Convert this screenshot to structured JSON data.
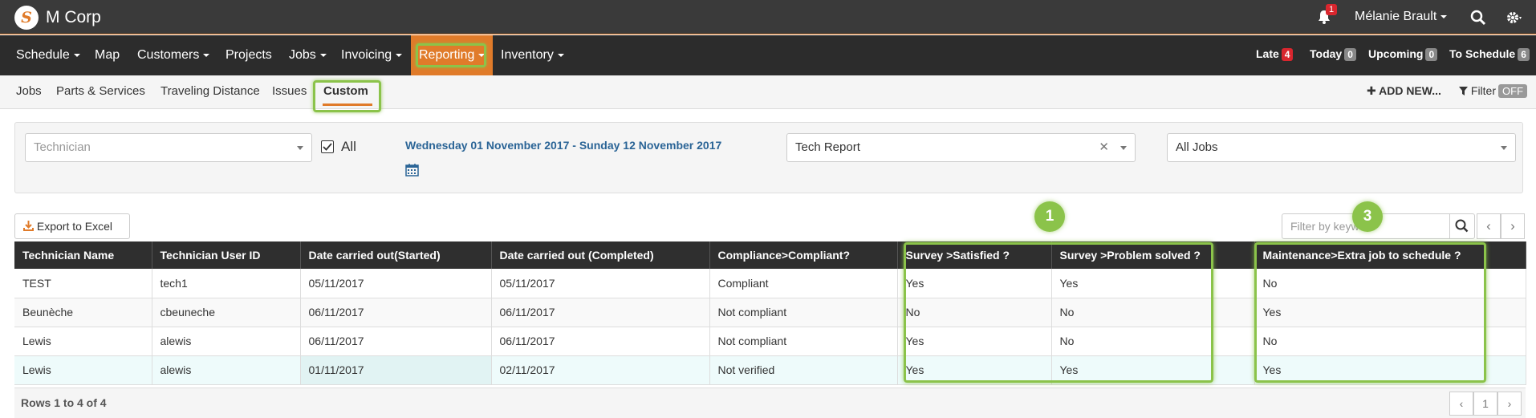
{
  "app": {
    "brand": "M Corp",
    "logo_letter": "S"
  },
  "topbar": {
    "notification_count": "1",
    "user_name": "Mélanie Brault"
  },
  "main_nav": {
    "items": [
      "Schedule",
      "Map",
      "Customers",
      "Projects",
      "Jobs",
      "Invoicing",
      "Reporting",
      "Inventory"
    ],
    "status": [
      {
        "label": "Late",
        "count": "4",
        "color": "#d9262e"
      },
      {
        "label": "Today",
        "count": "0",
        "color": "#888888"
      },
      {
        "label": "Upcoming",
        "count": "0",
        "color": "#888888"
      },
      {
        "label": "To Schedule",
        "count": "6",
        "color": "#888888"
      }
    ]
  },
  "sub_nav": {
    "items": [
      "Jobs",
      "Parts & Services",
      "Traveling Distance",
      "Issues",
      "Custom"
    ],
    "add_new": "✚ ADD NEW...",
    "filter_label": "Filter",
    "filter_state": "OFF"
  },
  "filters": {
    "technician_placeholder": "Technician",
    "all_label": "All",
    "date_range": "Wednesday 01 November 2017 - Sunday 12 November 2017",
    "report": "Tech Report",
    "jobs": "All Jobs"
  },
  "toolbar": {
    "export_label": "Export to Excel",
    "keyword_placeholder": "Filter by keyword"
  },
  "table": {
    "columns": [
      "Technician Name",
      "Technician User ID",
      "Date carried out(Started)",
      "Date carried out (Completed)",
      "Compliance>Compliant?",
      "Survey >Satisfied ?",
      "Survey >Problem solved ?",
      "Maintenance>Extra job to schedule ?"
    ],
    "rows": [
      [
        "TEST",
        "tech1",
        "05/11/2017",
        "05/11/2017",
        "Compliant",
        "Yes",
        "Yes",
        "No"
      ],
      [
        "Beunèche",
        "cbeuneche",
        "06/11/2017",
        "06/11/2017",
        "Not compliant",
        "No",
        "No",
        "Yes"
      ],
      [
        "Lewis",
        "alewis",
        "06/11/2017",
        "06/11/2017",
        "Not compliant",
        "Yes",
        "No",
        "No"
      ],
      [
        "Lewis",
        "alewis",
        "01/11/2017",
        "02/11/2017",
        "Not verified",
        "Yes",
        "Yes",
        "Yes"
      ]
    ],
    "rows_summary": "Rows 1 to 4 of 4",
    "page": "1"
  },
  "annotations": {
    "marker_1": "1",
    "marker_3": "3"
  },
  "colors": {
    "accent": "#e07b2a",
    "highlight": "#8bc34a",
    "header_dark": "#2f2f2f",
    "link": "#2a6496"
  }
}
